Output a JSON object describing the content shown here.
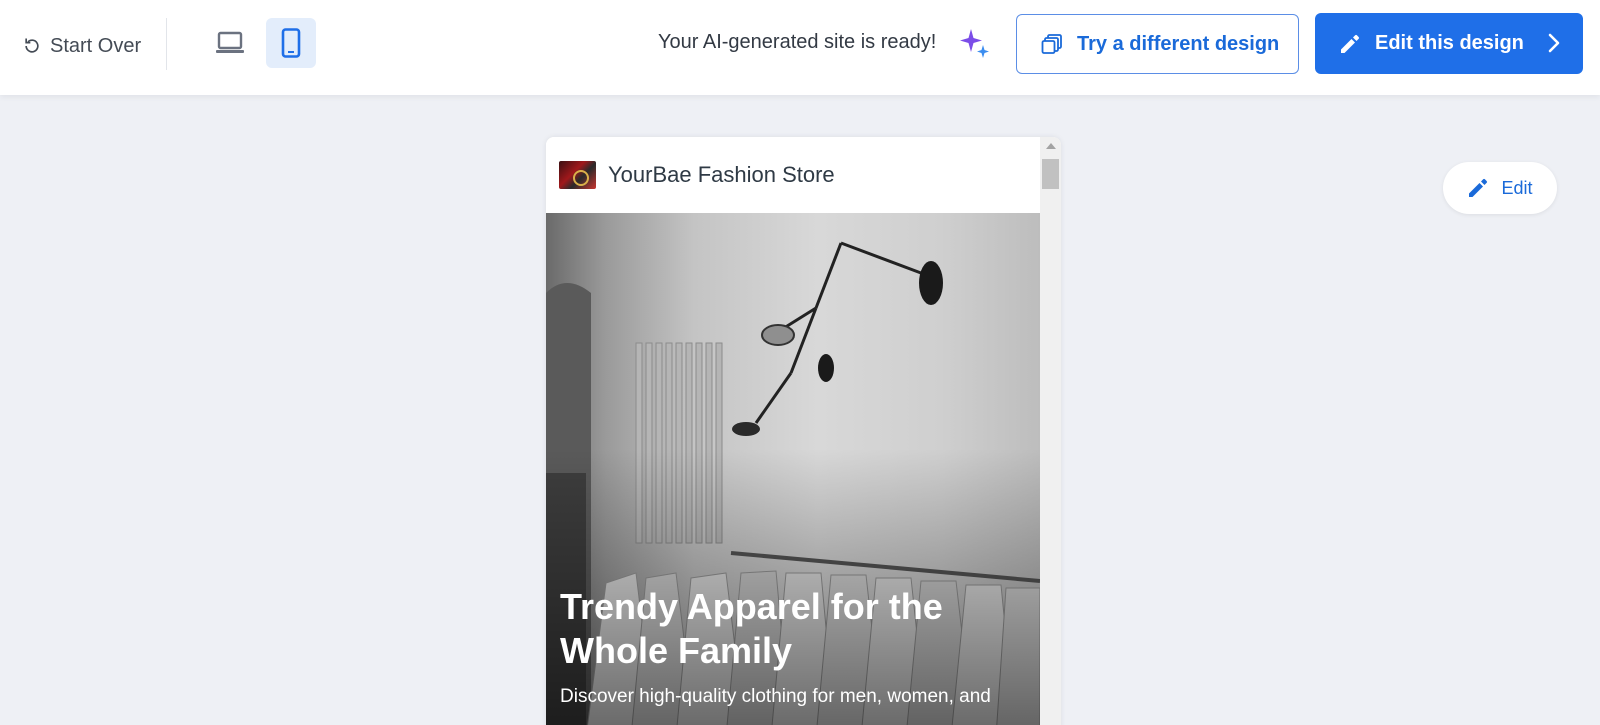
{
  "toolbar": {
    "start_over_label": "Start Over",
    "ready_text": "Your AI-generated site is ready!",
    "try_design_label": "Try a different design",
    "edit_design_label": "Edit this design"
  },
  "icons": {
    "start_over": "refresh-icon",
    "desktop": "laptop-icon",
    "mobile": "mobile-icon",
    "sparkle": "sparkle-icon",
    "try_design": "layers-icon",
    "edit_design": "pencil-icon",
    "chevron": "chevron-right-icon"
  },
  "colors": {
    "accent": "#1f6fe8",
    "mobile_active_bg": "#e3edfb",
    "sparkle_purple": "#7b4de8",
    "sparkle_blue": "#3b8df0"
  },
  "preview": {
    "site_name": "YourBae Fashion Store",
    "hero_title": "Trendy Apparel for the Whole Family",
    "hero_subtitle": "Discover high-quality clothing for men, women, and"
  },
  "floating_edit": {
    "label": "Edit"
  }
}
